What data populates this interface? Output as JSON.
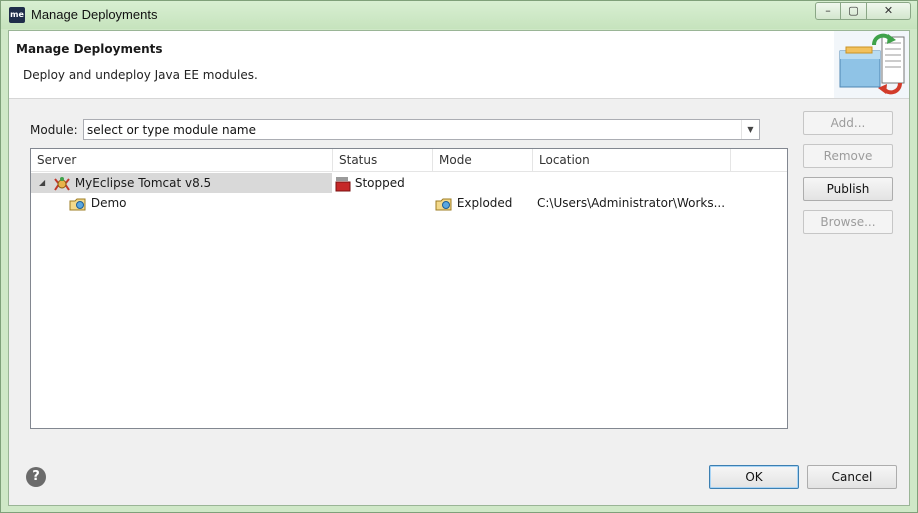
{
  "window": {
    "title": "Manage Deployments",
    "app_icon_text": "me",
    "caption": {
      "minimize": "–",
      "maximize": "▢",
      "close": "✕"
    }
  },
  "banner": {
    "title": "Manage Deployments",
    "description": "Deploy and undeploy Java EE modules."
  },
  "module": {
    "label": "Module:",
    "value": "select or type module name"
  },
  "table": {
    "columns": [
      "Server",
      "Status",
      "Mode",
      "Location"
    ],
    "rows": [
      {
        "server": "MyEclipse Tomcat v8.5",
        "status": "Stopped",
        "mode": "",
        "location": ""
      },
      {
        "server": "Demo",
        "status": "",
        "mode": "Exploded",
        "location": "C:\\Users\\Administrator\\Works..."
      }
    ]
  },
  "buttons": {
    "add": "Add...",
    "remove": "Remove",
    "publish": "Publish",
    "browse": "Browse...",
    "ok": "OK",
    "cancel": "Cancel"
  },
  "help_icon_text": "?",
  "icons": [
    "app-icon",
    "deploy-banner-icon",
    "tomcat-server-icon",
    "stopped-status-icon",
    "web-project-icon",
    "exploded-mode-icon",
    "help-icon",
    "expander-icon",
    "dropdown-arrow-icon"
  ]
}
